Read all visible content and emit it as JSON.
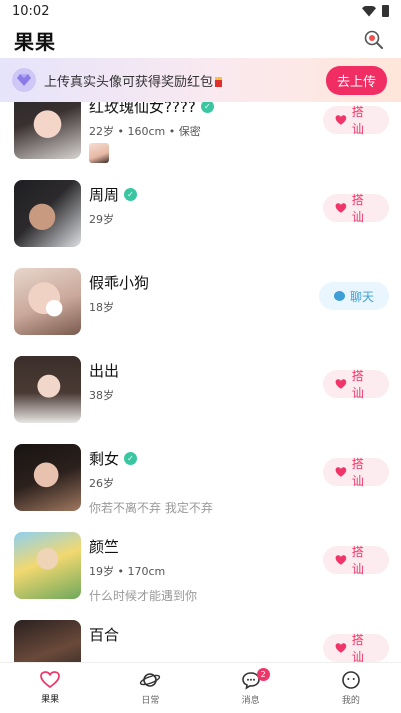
{
  "status_bar": {
    "time": "10:02"
  },
  "header": {
    "title": "果果"
  },
  "banner": {
    "text": "上传真实头像可获得奖励红包",
    "button": "去上传"
  },
  "users": [
    {
      "name": "红玫瑰仙女????",
      "verified": true,
      "meta": "22岁 • 160cm • 保密",
      "bio": "",
      "action": "搭 讪",
      "action_type": "chat-up",
      "has_mini_photo": true
    },
    {
      "name": "周周",
      "verified": true,
      "meta": "29岁",
      "bio": "",
      "action": "搭 讪",
      "action_type": "chat-up"
    },
    {
      "name": "假乖小狗",
      "verified": false,
      "meta": "18岁",
      "bio": "",
      "action": "聊天",
      "action_type": "chat"
    },
    {
      "name": "出出",
      "verified": false,
      "meta": "38岁",
      "bio": "",
      "action": "搭 讪",
      "action_type": "chat-up"
    },
    {
      "name": "剩女",
      "verified": true,
      "meta": "26岁",
      "bio": "你若不离不弃 我定不弃",
      "action": "搭 讪",
      "action_type": "chat-up"
    },
    {
      "name": "颜竺",
      "verified": false,
      "meta": "19岁 • 170cm",
      "bio": "什么时候才能遇到你",
      "action": "搭 讪",
      "action_type": "chat-up"
    },
    {
      "name": "百合",
      "verified": false,
      "meta": "",
      "bio": "",
      "action": "搭 讪",
      "action_type": "chat-up"
    }
  ],
  "tabs": [
    {
      "label": "果果",
      "icon": "heart-icon",
      "active": true
    },
    {
      "label": "日常",
      "icon": "planet-icon",
      "active": false
    },
    {
      "label": "消息",
      "icon": "message-icon",
      "active": false,
      "badge": "2"
    },
    {
      "label": "我的",
      "icon": "profile-icon",
      "active": false
    }
  ],
  "colors": {
    "accent": "#f02e63",
    "verified": "#3bc6a2",
    "chat": "#3d9fd6"
  }
}
